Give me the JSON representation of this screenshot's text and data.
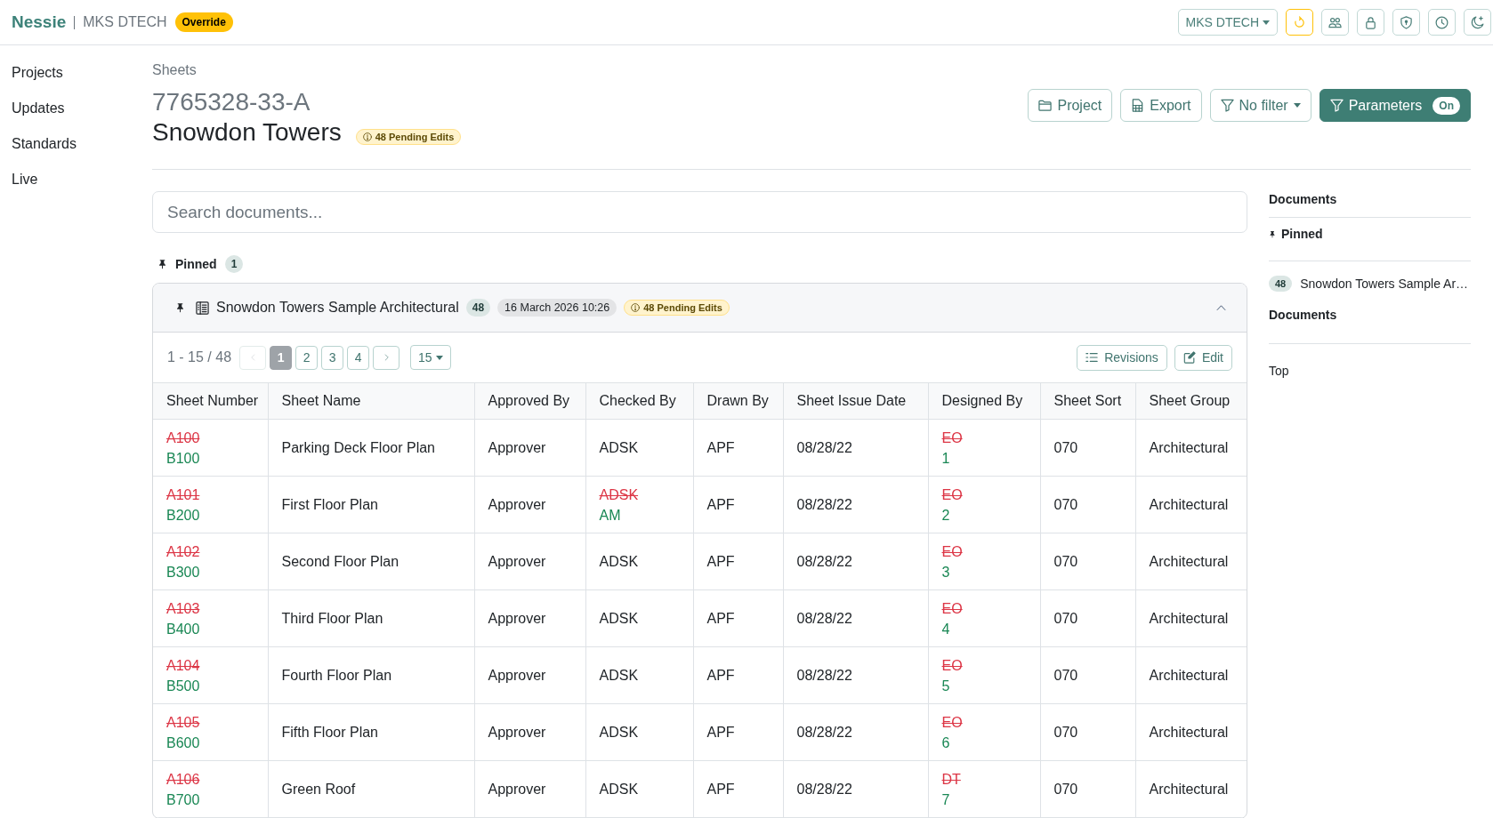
{
  "topbar": {
    "brand": "Nessie",
    "org": "MKS DTECH",
    "mode_badge": "Override",
    "org_menu": "MKS DTECH",
    "icon_buttons": [
      {
        "kind": "refresh",
        "active": true
      },
      {
        "kind": "users",
        "active": false
      },
      {
        "kind": "lock",
        "active": false
      },
      {
        "kind": "shield",
        "active": false
      },
      {
        "kind": "history",
        "active": false
      },
      {
        "kind": "theme",
        "active": false
      }
    ]
  },
  "nav": {
    "items": [
      "Projects",
      "Updates",
      "Standards",
      "Live"
    ]
  },
  "page": {
    "breadcrumb": "Sheets",
    "project_number": "7765328-33-A",
    "project_name": "Snowdon Towers",
    "pending_badge": "48 Pending Edits",
    "actions": [
      {
        "kind": "project",
        "label": "Project",
        "dropdown": false,
        "active": false
      },
      {
        "kind": "export",
        "label": "Export",
        "dropdown": false,
        "active": false
      },
      {
        "kind": "filter",
        "label": "No filter",
        "dropdown": true,
        "active": false
      },
      {
        "kind": "parameters",
        "label": "Parameters",
        "dropdown": false,
        "active": true,
        "toggle": "On"
      }
    ]
  },
  "search": {
    "placeholder": "Search documents..."
  },
  "pinned": {
    "label": "Pinned",
    "count": "1"
  },
  "document": {
    "pinned": true,
    "title": "Snowdon Towers Sample Architectural",
    "count": "48",
    "date": "16 March 2026 10:26",
    "pending_badge": "48 Pending Edits",
    "expanded": true,
    "pagination": {
      "range": "1 - 15 / 48",
      "prev_disabled": true,
      "pages": [
        {
          "label": "1",
          "selected": true
        },
        {
          "label": "2",
          "selected": false
        },
        {
          "label": "3",
          "selected": false
        },
        {
          "label": "4",
          "selected": false
        }
      ],
      "next_disabled": false,
      "page_size": "15"
    },
    "tools": [
      {
        "kind": "revisions",
        "label": "Revisions"
      },
      {
        "kind": "edit",
        "label": "Edit"
      }
    ],
    "table": {
      "columns": [
        "Sheet Number",
        "Sheet Name",
        "Approved By",
        "Checked By",
        "Drawn By",
        "Sheet Issue Date",
        "Designed By",
        "Sheet Sort",
        "Sheet Group"
      ],
      "rows": [
        {
          "cells": [
            {
              "kind": "changed",
              "old": "A100",
              "new": "B100"
            },
            {
              "kind": "plain",
              "text": "Parking Deck Floor Plan"
            },
            {
              "kind": "plain",
              "text": "Approver"
            },
            {
              "kind": "plain",
              "text": "ADSK"
            },
            {
              "kind": "plain",
              "text": "APF"
            },
            {
              "kind": "plain",
              "text": "08/28/22"
            },
            {
              "kind": "changed",
              "old": "EO",
              "new": "1"
            },
            {
              "kind": "plain",
              "text": "070"
            },
            {
              "kind": "plain",
              "text": "Architectural"
            }
          ]
        },
        {
          "cells": [
            {
              "kind": "changed",
              "old": "A101",
              "new": "B200"
            },
            {
              "kind": "plain",
              "text": "First Floor Plan"
            },
            {
              "kind": "plain",
              "text": "Approver"
            },
            {
              "kind": "changed",
              "old": "ADSK",
              "new": "AM"
            },
            {
              "kind": "plain",
              "text": "APF"
            },
            {
              "kind": "plain",
              "text": "08/28/22"
            },
            {
              "kind": "changed",
              "old": "EO",
              "new": "2"
            },
            {
              "kind": "plain",
              "text": "070"
            },
            {
              "kind": "plain",
              "text": "Architectural"
            }
          ]
        },
        {
          "cells": [
            {
              "kind": "changed",
              "old": "A102",
              "new": "B300"
            },
            {
              "kind": "plain",
              "text": "Second Floor Plan"
            },
            {
              "kind": "plain",
              "text": "Approver"
            },
            {
              "kind": "plain",
              "text": "ADSK"
            },
            {
              "kind": "plain",
              "text": "APF"
            },
            {
              "kind": "plain",
              "text": "08/28/22"
            },
            {
              "kind": "changed",
              "old": "EO",
              "new": "3"
            },
            {
              "kind": "plain",
              "text": "070"
            },
            {
              "kind": "plain",
              "text": "Architectural"
            }
          ]
        },
        {
          "cells": [
            {
              "kind": "changed",
              "old": "A103",
              "new": "B400"
            },
            {
              "kind": "plain",
              "text": "Third Floor Plan"
            },
            {
              "kind": "plain",
              "text": "Approver"
            },
            {
              "kind": "plain",
              "text": "ADSK"
            },
            {
              "kind": "plain",
              "text": "APF"
            },
            {
              "kind": "plain",
              "text": "08/28/22"
            },
            {
              "kind": "changed",
              "old": "EO",
              "new": "4"
            },
            {
              "kind": "plain",
              "text": "070"
            },
            {
              "kind": "plain",
              "text": "Architectural"
            }
          ]
        },
        {
          "cells": [
            {
              "kind": "changed",
              "old": "A104",
              "new": "B500"
            },
            {
              "kind": "plain",
              "text": "Fourth Floor Plan"
            },
            {
              "kind": "plain",
              "text": "Approver"
            },
            {
              "kind": "plain",
              "text": "ADSK"
            },
            {
              "kind": "plain",
              "text": "APF"
            },
            {
              "kind": "plain",
              "text": "08/28/22"
            },
            {
              "kind": "changed",
              "old": "EO",
              "new": "5"
            },
            {
              "kind": "plain",
              "text": "070"
            },
            {
              "kind": "plain",
              "text": "Architectural"
            }
          ]
        },
        {
          "cells": [
            {
              "kind": "changed",
              "old": "A105",
              "new": "B600"
            },
            {
              "kind": "plain",
              "text": "Fifth Floor Plan"
            },
            {
              "kind": "plain",
              "text": "Approver"
            },
            {
              "kind": "plain",
              "text": "ADSK"
            },
            {
              "kind": "plain",
              "text": "APF"
            },
            {
              "kind": "plain",
              "text": "08/28/22"
            },
            {
              "kind": "changed",
              "old": "EO",
              "new": "6"
            },
            {
              "kind": "plain",
              "text": "070"
            },
            {
              "kind": "plain",
              "text": "Architectural"
            }
          ]
        },
        {
          "cells": [
            {
              "kind": "changed",
              "old": "A106",
              "new": "B700"
            },
            {
              "kind": "plain",
              "text": "Green Roof"
            },
            {
              "kind": "plain",
              "text": "Approver"
            },
            {
              "kind": "plain",
              "text": "ADSK"
            },
            {
              "kind": "plain",
              "text": "APF"
            },
            {
              "kind": "plain",
              "text": "08/28/22"
            },
            {
              "kind": "changed",
              "old": "DT",
              "new": "7"
            },
            {
              "kind": "plain",
              "text": "070"
            },
            {
              "kind": "plain",
              "text": "Architectural"
            }
          ]
        }
      ]
    }
  },
  "outline": {
    "items": [
      {
        "kind": "heading",
        "label": "Documents"
      },
      {
        "kind": "pinned",
        "label": "Pinned"
      },
      {
        "kind": "document",
        "count": "48",
        "label": "Snowdon Towers Sample Ar…"
      },
      {
        "kind": "heading",
        "label": "Documents"
      },
      {
        "kind": "link",
        "label": "Top"
      }
    ]
  }
}
